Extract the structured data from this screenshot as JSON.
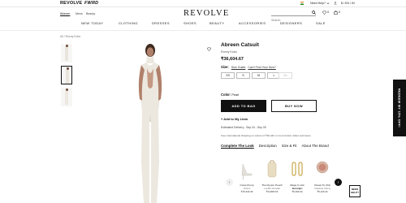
{
  "topbar": {
    "brand_tabs": [
      "REVOLVE",
      "FWRD"
    ],
    "need_help": "Need Help?",
    "currency": "INR",
    "account_label": "$ / EN / IN"
  },
  "header": {
    "gender_tabs": [
      "Women",
      "Mens",
      "Beauty"
    ],
    "logo": "REVOLVE",
    "search_placeholder": "Search",
    "wishlist_count": "0",
    "cart_count": "0"
  },
  "nav": {
    "items": [
      "NEW TODAY",
      "CLOTHING",
      "DRESSES",
      "SHOES",
      "BEAUTY",
      "ACCESSORIES",
      "DESIGNERS",
      "SALE"
    ]
  },
  "breadcrumb": "All  /  Ronny Kobo",
  "product": {
    "title": "Abreen Catsuit",
    "designer": "Ronny Kobo",
    "price": "₹36,604.67",
    "size_label": "Size:",
    "size_guide": "Size Guide",
    "cant_find": "Can't Find Your Size?",
    "sizes": [
      "XS",
      "S",
      "M",
      "L",
      "XL"
    ],
    "color_label": "Color:",
    "color_value": "Pearl",
    "add_to_bag": "ADD TO BAG",
    "buy_now": "BUY NOW",
    "add_to_list": "+ Add to My Lists",
    "estimated_delivery": "Estimated Delivery : Sep 04 - Sep 09",
    "shipping_note": "Free international shipping on orders of ₹30,442 or more before duties and taxes",
    "tabs": [
      "Complete The Look",
      "Description",
      "Size & Fit",
      "About The Brand"
    ]
  },
  "look": [
    {
      "name": "Cress Pump",
      "brand": "Schutz",
      "price": "₹15,334.36"
    },
    {
      "name": "The Peyton Pouch",
      "brand": "Loeffler Randall",
      "price": "₹34,883.53"
    },
    {
      "name": "Mega U Link Earrings",
      "brand": "Jenny Bird",
      "price": "₹9,499.34"
    },
    {
      "name": "Cheek To Chic",
      "brand": "Charlotte Tilbury",
      "price": "₹5,109.34"
    }
  ],
  "help_button": "NEED HELP?",
  "promo_tab": "REDEEM MY 15% OFF!",
  "colors": {
    "ink": "#111111",
    "catsuit": "#ece8df",
    "promo_bg": "#111111"
  }
}
